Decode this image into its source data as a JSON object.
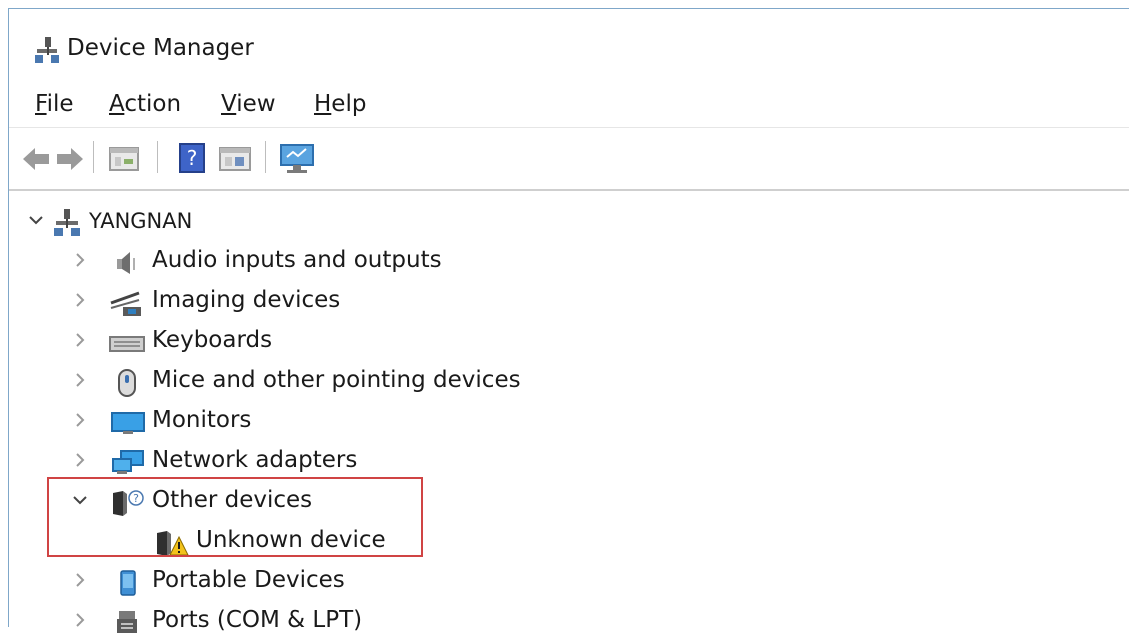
{
  "window": {
    "title": "Device Manager"
  },
  "menu": [
    {
      "prefix": "",
      "key": "F",
      "rest": "ile"
    },
    {
      "prefix": "",
      "key": "A",
      "rest": "ction"
    },
    {
      "prefix": "",
      "key": "V",
      "rest": "iew"
    },
    {
      "prefix": "",
      "key": "H",
      "rest": "elp"
    }
  ],
  "toolbar": {
    "icons": [
      "back-arrow-icon",
      "forward-arrow-icon",
      "properties-icon",
      "help-icon",
      "details-view-icon",
      "scan-hardware-icon"
    ]
  },
  "tree": {
    "root": {
      "label": "YANGNAN",
      "expanded": true
    },
    "items": [
      {
        "label": "Audio inputs and outputs",
        "icon": "speaker-icon",
        "expanded": false
      },
      {
        "label": "Imaging devices",
        "icon": "camera-icon",
        "expanded": false
      },
      {
        "label": "Keyboards",
        "icon": "keyboard-icon",
        "expanded": false
      },
      {
        "label": "Mice and other pointing devices",
        "icon": "mouse-icon",
        "expanded": false
      },
      {
        "label": "Monitors",
        "icon": "monitor-icon",
        "expanded": false
      },
      {
        "label": "Network adapters",
        "icon": "network-icon",
        "expanded": false
      },
      {
        "label": "Other devices",
        "icon": "unknown-device-icon",
        "expanded": true
      },
      {
        "label": "Unknown device",
        "icon": "warning-device-icon",
        "child": true
      },
      {
        "label": "Portable Devices",
        "icon": "portable-device-icon",
        "expanded": false
      },
      {
        "label": "Ports (COM & LPT)",
        "icon": "port-icon",
        "expanded": false
      }
    ]
  },
  "colors": {
    "highlight": "#d04444",
    "window_border": "#7fa7c9"
  }
}
